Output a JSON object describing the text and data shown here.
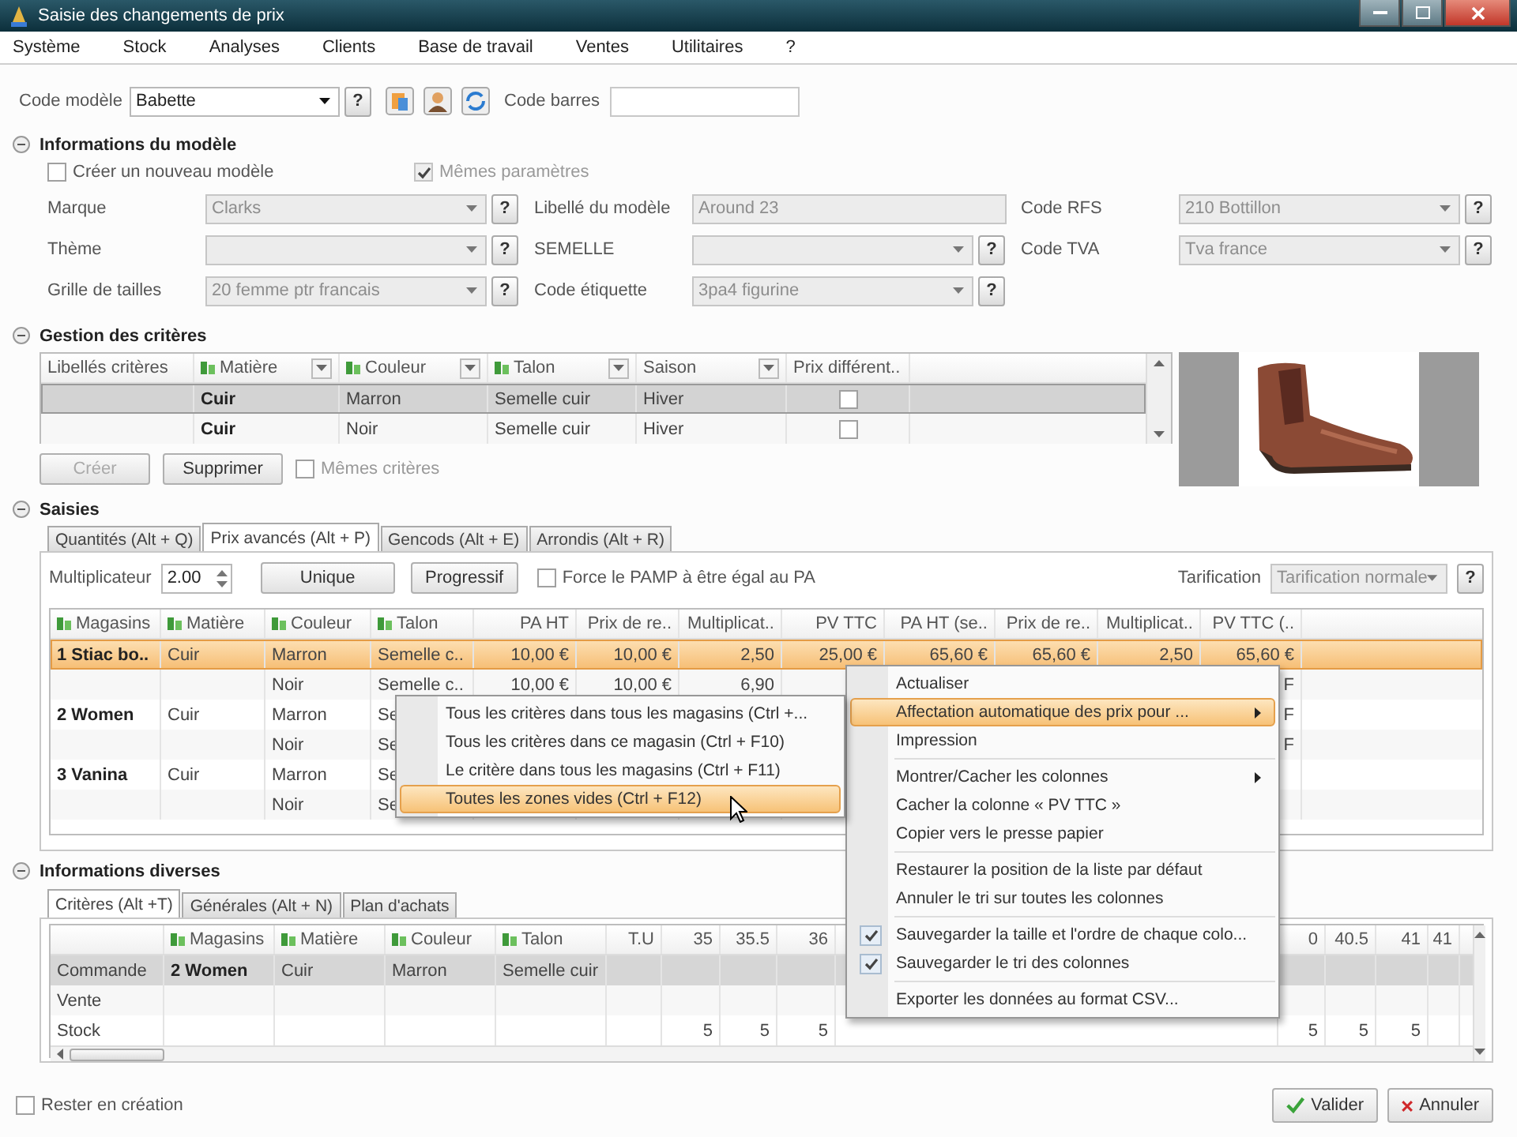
{
  "window": {
    "title": "Saisie des changements de prix"
  },
  "menu_bar": [
    "Système",
    "Stock",
    "Analyses",
    "Clients",
    "Base de travail",
    "Ventes",
    "Utilitaires",
    "?"
  ],
  "model_bar": {
    "label": "Code modèle",
    "value": "Babette",
    "help": "?",
    "barcode_label": "Code barres"
  },
  "model_info": {
    "title": "Informations du modèle",
    "expanded": true,
    "options": [
      {
        "label": "Créer un nouveau modèle",
        "checked": false,
        "disabled": false
      },
      {
        "label": "Mêmes paramètres",
        "checked": true,
        "disabled": true
      }
    ],
    "fields": [
      {
        "label": "Marque",
        "kind": "combo",
        "value": "Clarks",
        "help": "?",
        "disabled": true
      },
      {
        "label": "Libellé du modèle",
        "kind": "text",
        "value": "Around 23",
        "disabled": true
      },
      {
        "label": "Code RFS",
        "kind": "combo",
        "value": "210 Bottillon",
        "help": "?",
        "disabled": true
      },
      {
        "label": "Thème",
        "kind": "combo",
        "help": "?",
        "disabled": true
      },
      {
        "label": "SEMELLE",
        "kind": "combo",
        "help": "?",
        "disabled": true
      },
      {
        "label": "Code TVA",
        "kind": "combo",
        "value": "Tva france",
        "help": "?",
        "disabled": true
      },
      {
        "label": "Grille de tailles",
        "kind": "combo",
        "value": "20 femme ptr francais",
        "help": "?",
        "disabled": true
      },
      {
        "label": "Code étiquette",
        "kind": "combo",
        "value": "3pa4 figurine",
        "help": "?",
        "disabled": true
      }
    ]
  },
  "criteria": {
    "title": "Gestion des critères",
    "expanded": true,
    "columns": [
      {
        "label": "Libellés critères",
        "kind": "text",
        "filter": false
      },
      {
        "label": "Matière",
        "kind": "criterion",
        "filter": true
      },
      {
        "label": "Couleur",
        "kind": "criterion",
        "filter": true
      },
      {
        "label": "Talon",
        "kind": "criterion",
        "filter": true
      },
      {
        "label": "Saison",
        "kind": "text",
        "filter": true
      },
      {
        "label": "Prix différent..",
        "kind": "text",
        "filter": false
      }
    ],
    "rows": [
      {
        "selected": true,
        "cells": [
          null,
          "Cuir",
          "Marron",
          "Semelle cuir",
          "Hiver"
        ],
        "price_differs": false
      },
      {
        "selected": false,
        "cells": [
          null,
          "Cuir",
          "Noir",
          "Semelle cuir",
          "Hiver"
        ],
        "price_differs": false
      }
    ],
    "buttons": [
      {
        "label": "Créer",
        "disabled": true
      },
      {
        "label": "Supprimer",
        "disabled": false
      }
    ],
    "same_criteria": {
      "label": "Mêmes critères",
      "checked": false
    }
  },
  "saisies": {
    "title": "Saisies",
    "expanded": true,
    "tabs": [
      {
        "label": "Quantités (Alt + Q)",
        "selected": false
      },
      {
        "label": "Prix avancés (Alt + P)",
        "selected": true
      },
      {
        "label": "Gencods (Alt + E)",
        "selected": false
      },
      {
        "label": "Arrondis (Alt + R)",
        "selected": false
      }
    ],
    "multiplier": {
      "label": "Multiplicateur",
      "value": "2.00"
    },
    "buttons": [
      "Unique",
      "Progressif"
    ],
    "force_pamp": {
      "label": "Force le PAMP à être égal au PA",
      "checked": false
    },
    "pricing": {
      "label": "Tarification",
      "value": "Tarification normale",
      "help": "?",
      "disabled": true
    },
    "grid": {
      "columns": [
        {
          "label": "Magasins",
          "kind": "criterion"
        },
        {
          "label": "Matière",
          "kind": "criterion"
        },
        {
          "label": "Couleur",
          "kind": "criterion"
        },
        {
          "label": "Talon",
          "kind": "criterion"
        },
        {
          "label": "PA HT",
          "kind": "number"
        },
        {
          "label": "Prix de re..",
          "kind": "number"
        },
        {
          "label": "Multiplicat..",
          "kind": "number"
        },
        {
          "label": "PV TTC",
          "kind": "number"
        },
        {
          "label": "PA HT (se..",
          "kind": "number"
        },
        {
          "label": "Prix de re..",
          "kind": "number"
        },
        {
          "label": "Multiplicat..",
          "kind": "number"
        },
        {
          "label": "PV TTC (..",
          "kind": "number"
        }
      ],
      "rows": [
        {
          "selected": true,
          "cells": [
            "1 Stiac bo..",
            "Cuir",
            "Marron",
            "Semelle c..",
            "10,00 €",
            "10,00 €",
            "2,50",
            "25,00 €",
            "65,60 €",
            "65,60 €",
            "2,50",
            "65,60 €"
          ]
        },
        {
          "selected": false,
          "cells": [
            null,
            null,
            "Noir",
            "Semelle c..",
            "10,00 €",
            "10,00 €",
            "6,90",
            null,
            null,
            null,
            null,
            "F"
          ]
        },
        {
          "selected": false,
          "cells": [
            "2 Women",
            "Cuir",
            "Marron",
            "Se",
            null,
            null,
            null,
            null,
            null,
            null,
            null,
            "F"
          ]
        },
        {
          "selected": false,
          "cells": [
            null,
            null,
            "Noir",
            "Se",
            null,
            null,
            null,
            null,
            null,
            null,
            null,
            "F"
          ]
        },
        {
          "selected": false,
          "cells": [
            "3 Vanina",
            "Cuir",
            "Marron",
            "Se",
            null,
            null,
            null,
            null,
            null,
            null,
            null,
            null
          ]
        },
        {
          "selected": false,
          "cells": [
            null,
            null,
            "Noir",
            "Se",
            null,
            null,
            null,
            null,
            null,
            null,
            null,
            null
          ]
        }
      ]
    }
  },
  "divers": {
    "title": "Informations diverses",
    "expanded": true,
    "tabs": [
      {
        "label": "Critères (Alt +T)",
        "selected": true
      },
      {
        "label": "Générales (Alt + N)",
        "selected": false
      },
      {
        "label": "Plan d'achats",
        "selected": false
      }
    ],
    "grid": {
      "columns": [
        {
          "kind": "text"
        },
        {
          "label": "Magasins",
          "kind": "criterion"
        },
        {
          "label": "Matière",
          "kind": "criterion"
        },
        {
          "label": "Couleur",
          "kind": "criterion"
        },
        {
          "label": "Talon",
          "kind": "criterion"
        },
        {
          "label": "T.U",
          "kind": "number"
        },
        {
          "label": "35",
          "kind": "number"
        },
        {
          "label": "35.5",
          "kind": "number"
        },
        {
          "label": "36",
          "kind": "number"
        },
        {
          "label": "0",
          "kind": "number"
        },
        {
          "label": "40.5",
          "kind": "number"
        },
        {
          "label": "41",
          "kind": "number"
        },
        {
          "label": "41",
          "kind": "number"
        }
      ],
      "rows": [
        {
          "selected": true,
          "cells": [
            "Commande",
            "2 Women",
            "Cuir",
            "Marron",
            "Semelle cuir",
            null,
            null,
            null,
            null,
            null,
            null,
            null,
            null
          ]
        },
        {
          "selected": false,
          "cells": [
            "Vente",
            null,
            null,
            null,
            null,
            null,
            null,
            null,
            null,
            null,
            null,
            null,
            null
          ]
        },
        {
          "selected": false,
          "cells": [
            "Stock",
            null,
            null,
            null,
            null,
            null,
            "5",
            "5",
            "5",
            "5",
            "5",
            "5",
            null
          ]
        }
      ]
    }
  },
  "footer": {
    "stay": {
      "label": "Rester en création",
      "checked": false
    },
    "buttons": [
      {
        "label": "Valider",
        "kind": "ok"
      },
      {
        "label": "Annuler",
        "kind": "cancel"
      }
    ]
  },
  "context_menu": {
    "groups": [
      [
        {
          "label": "Actualiser",
          "selected": false,
          "submenu": false
        },
        {
          "label": "Affectation automatique des prix pour ...",
          "selected": true,
          "submenu": true
        },
        {
          "label": "Impression",
          "selected": false,
          "submenu": false
        }
      ],
      [
        {
          "label": "Montrer/Cacher les colonnes",
          "selected": false,
          "submenu": true
        },
        {
          "label": "Cacher la colonne « PV TTC »",
          "selected": false,
          "submenu": false
        },
        {
          "label": "Copier vers le presse papier",
          "selected": false,
          "submenu": false
        }
      ],
      [
        {
          "label": "Restaurer la position de la liste par défaut",
          "selected": false,
          "submenu": false
        },
        {
          "label": "Annuler le tri sur toutes les colonnes",
          "selected": false,
          "submenu": false
        }
      ],
      [
        {
          "label": "Sauvegarder la taille et l'ordre de chaque colo...",
          "selected": false,
          "submenu": false,
          "checked": true
        },
        {
          "label": "Sauvegarder le tri des colonnes",
          "selected": false,
          "submenu": false,
          "checked": true
        }
      ],
      [
        {
          "label": "Exporter les données au format CSV...",
          "selected": false,
          "submenu": false
        }
      ]
    ]
  },
  "submenu": {
    "items": [
      {
        "label": "Tous les critères dans tous les magasins (Ctrl +...",
        "selected": false
      },
      {
        "label": "Tous les critères dans ce magasin (Ctrl + F10)",
        "selected": false
      },
      {
        "label": "Le critère dans tous les magasins (Ctrl + F11)",
        "selected": false
      },
      {
        "label": "Toutes les zones vides (Ctrl + F12)",
        "selected": true
      }
    ]
  }
}
